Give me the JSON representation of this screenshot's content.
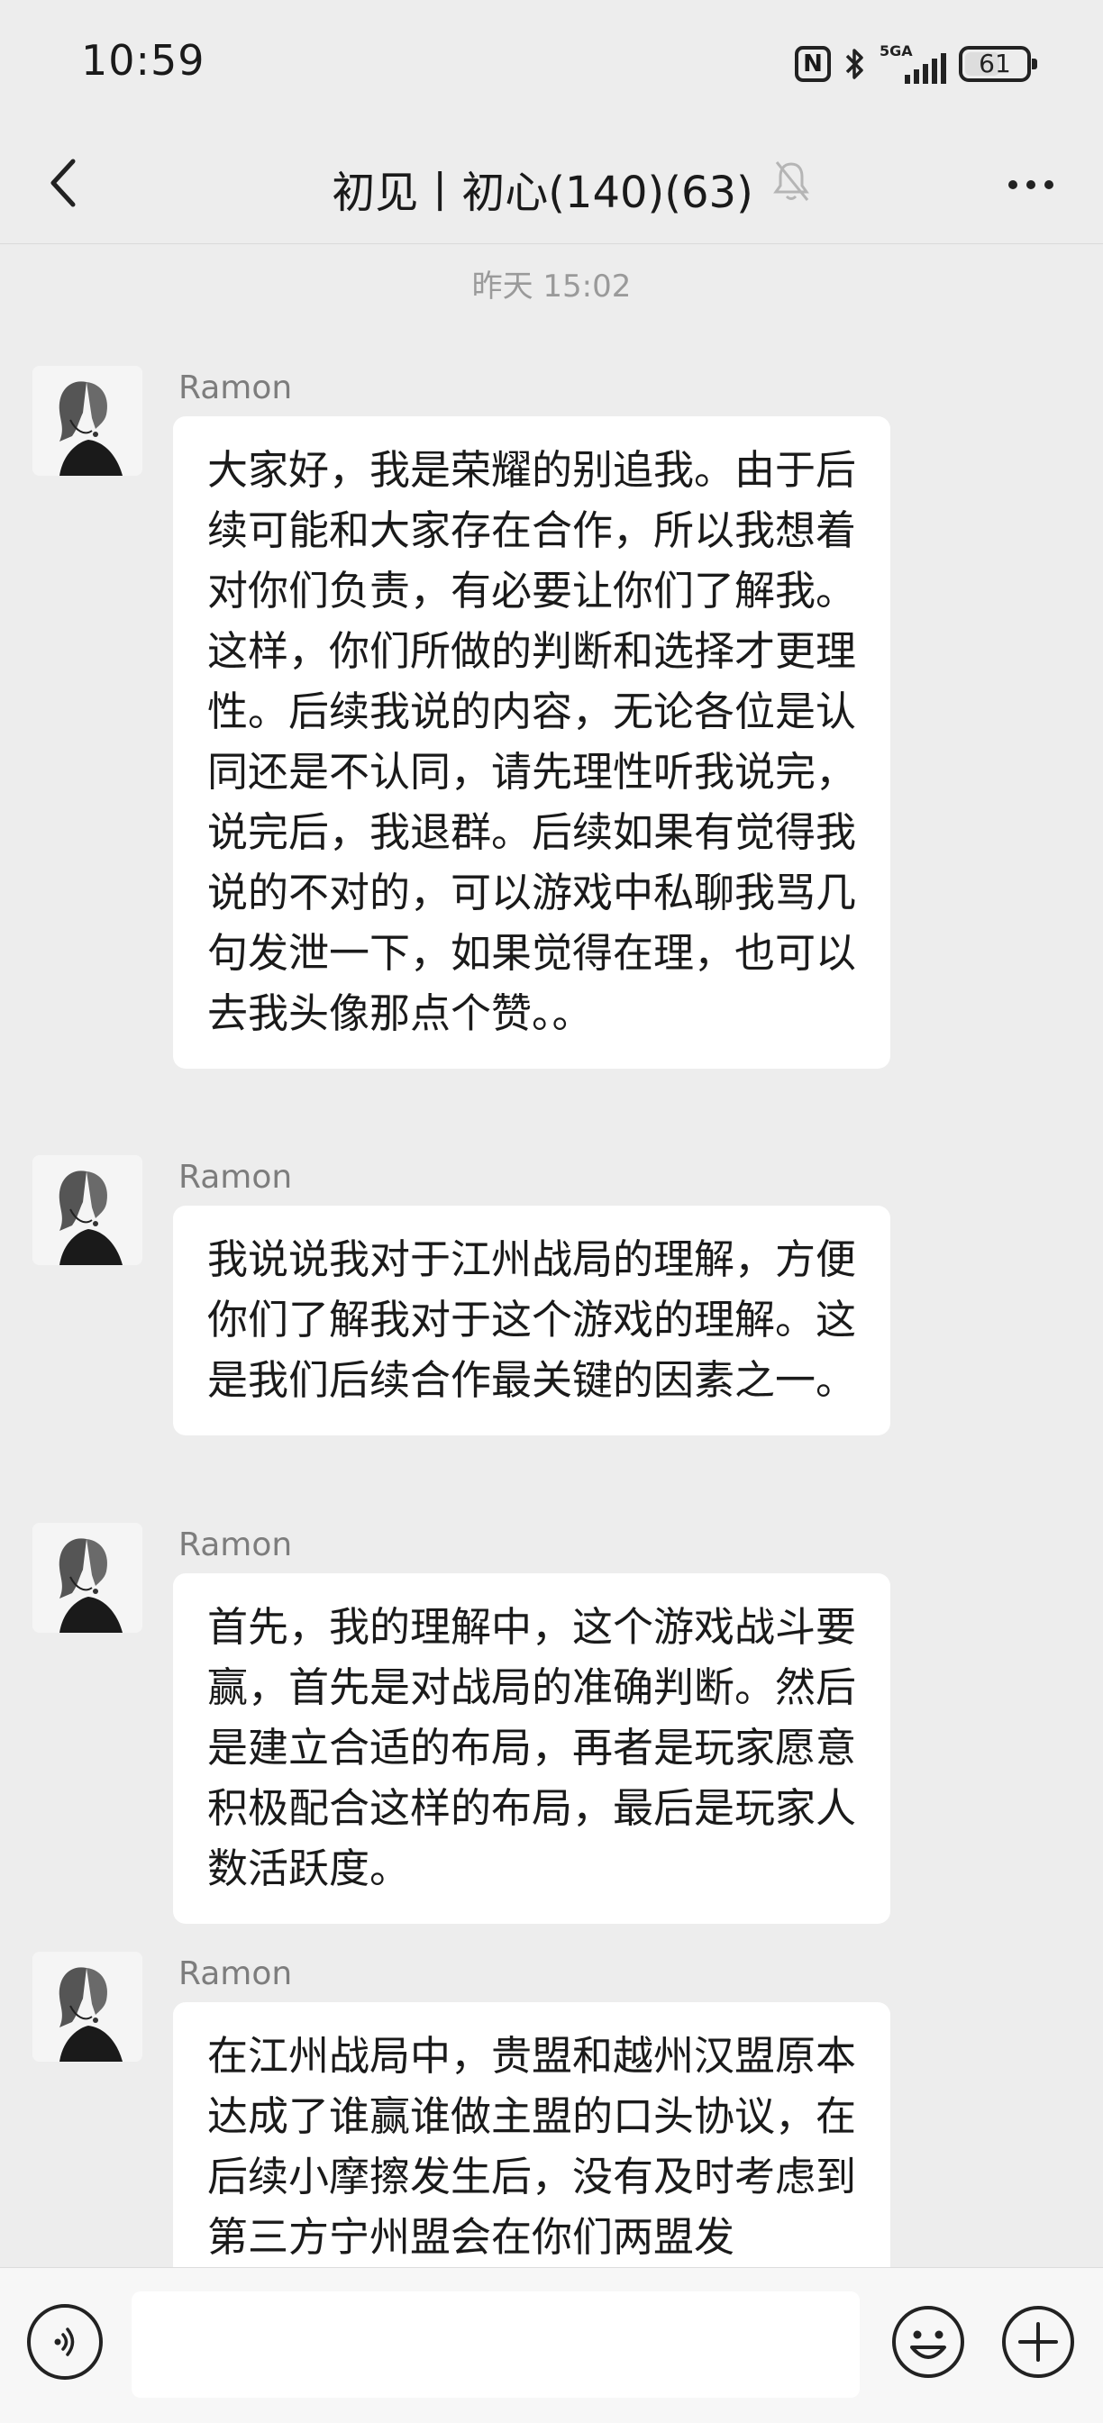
{
  "status": {
    "time": "10:59",
    "network": "5GA",
    "battery": "61",
    "battery_level": 0.61
  },
  "header": {
    "title": "初见丨初心(140)(63)"
  },
  "timestamp": "昨天 15:02",
  "messages": [
    {
      "sender": "Ramon",
      "text": "大家好，我是荣耀的别追我。由于后续可能和大家存在合作，所以我想着对你们负责，有必要让你们了解我。这样，你们所做的判断和选择才更理性。后续我说的内容，无论各位是认同还是不认同，请先理性听我说完，说完后，我退群。后续如果有觉得我说的不对的，可以游戏中私聊我骂几句发泄一下，如果觉得在理，也可以去我头像那点个赞。。"
    },
    {
      "sender": "Ramon",
      "text": "我说说我对于江州战局的理解，方便你们了解我对于这个游戏的理解。这是我们后续合作最关键的因素之一。"
    },
    {
      "sender": "Ramon",
      "text": "首先，我的理解中，这个游戏战斗要赢，首先是对战局的准确判断。然后是建立合适的布局，再者是玩家愿意积极配合这样的布局，最后是玩家人数活跃度。"
    },
    {
      "sender": "Ramon",
      "text": "在江州战局中，贵盟和越州汉盟原本达成了谁赢谁做主盟的口头协议，在后续小摩擦发生后，没有及时考虑到第三方宁州盟会在你们两盟发"
    }
  ],
  "input": {
    "value": "",
    "placeholder": ""
  },
  "icons": {
    "back": "chevron-left-icon",
    "mute": "bell-off-icon",
    "more": "more-dots-icon",
    "voice": "voice-icon",
    "emoji": "emoji-icon",
    "plus": "plus-circle-icon"
  }
}
